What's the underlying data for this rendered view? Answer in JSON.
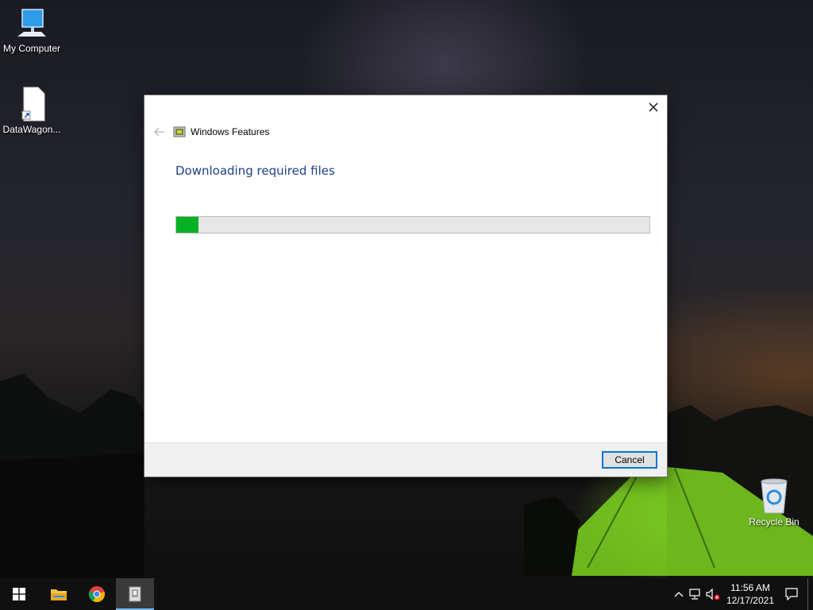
{
  "desktop": {
    "icons": [
      {
        "label": "My Computer",
        "icon": "monitor-icon"
      },
      {
        "label": "DataWagon...",
        "icon": "file-shortcut-icon"
      },
      {
        "label": "Recycle Bin",
        "icon": "recycle-bin-icon"
      }
    ]
  },
  "dialog": {
    "window_title": "Windows Features",
    "heading": "Downloading required files",
    "progress_fraction": 0.047,
    "cancel_label": "Cancel",
    "colors": {
      "heading": "#1e3f8a",
      "progress": "#06b025",
      "button_border": "#0078d7"
    }
  },
  "taskbar": {
    "apps": [
      {
        "name": "start",
        "icon": "windows-logo-icon"
      },
      {
        "name": "file-explorer",
        "icon": "folder-icon"
      },
      {
        "name": "chrome",
        "icon": "chrome-icon"
      },
      {
        "name": "windows-features",
        "icon": "windows-features-icon",
        "active": true
      }
    ],
    "tray": {
      "time": "11:56 AM",
      "date": "12/17/2021"
    }
  }
}
